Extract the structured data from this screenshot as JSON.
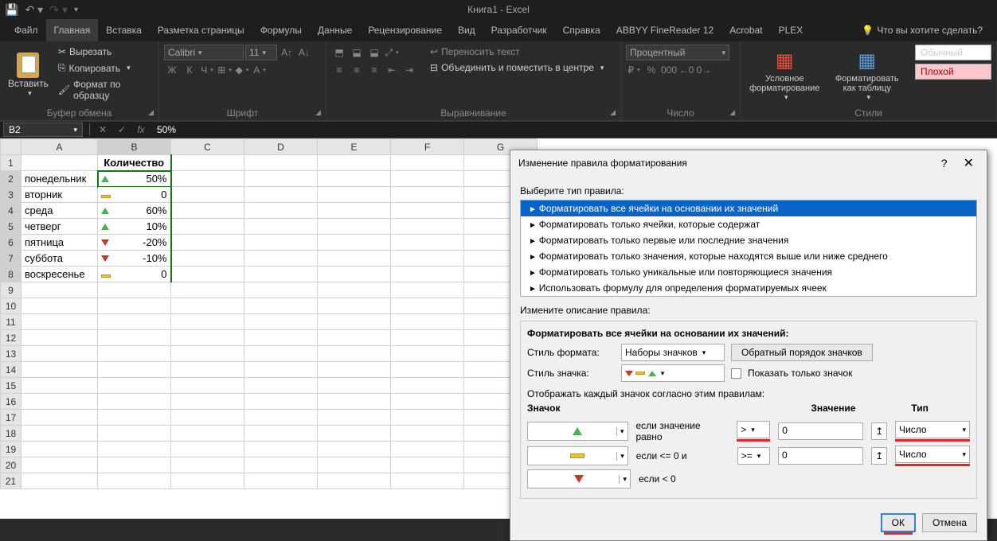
{
  "title": "Книга1 - Excel",
  "tabs": {
    "file": "Файл",
    "home": "Главная",
    "insert": "Вставка",
    "layout": "Разметка страницы",
    "formulas": "Формулы",
    "data": "Данные",
    "review": "Рецензирование",
    "view": "Вид",
    "dev": "Разработчик",
    "help": "Справка",
    "abbyy": "ABBYY FineReader 12",
    "acrobat": "Acrobat",
    "plex": "PLEX",
    "tellme": "Что вы хотите сделать?"
  },
  "clipboard": {
    "paste": "Вставить",
    "cut": "Вырезать",
    "copy": "Копировать",
    "format": "Формат по образцу",
    "label": "Буфер обмена"
  },
  "font": {
    "family": "Calibri",
    "size": "11",
    "label": "Шрифт",
    "bold": "Ж",
    "italic": "К",
    "underline": "Ч"
  },
  "align": {
    "label": "Выравнивание",
    "wrap": "Переносить текст",
    "merge": "Объединить и поместить в центре"
  },
  "number": {
    "label": "Число",
    "format": "Процентный"
  },
  "styles": {
    "label": "Стили",
    "cond": "Условное форматирование",
    "table": "Форматировать как таблицу",
    "normal": "Обычный",
    "bad": "Плохой"
  },
  "namebox": "B2",
  "formula": "50%",
  "columns": [
    "A",
    "B",
    "C",
    "D",
    "E",
    "F",
    "G"
  ],
  "rows": [
    "1",
    "2",
    "3",
    "4",
    "5",
    "6",
    "7",
    "8",
    "9",
    "10",
    "11",
    "12",
    "13",
    "14",
    "15",
    "16",
    "17",
    "18",
    "19",
    "20",
    "21"
  ],
  "data_cells": {
    "header": "Количество",
    "r": [
      {
        "a": "понедельник",
        "b": "50%",
        "i": "up"
      },
      {
        "a": "вторник",
        "b": "0",
        "i": "bar"
      },
      {
        "a": "среда",
        "b": "60%",
        "i": "up"
      },
      {
        "a": "четверг",
        "b": "10%",
        "i": "up"
      },
      {
        "a": "пятница",
        "b": "-20%",
        "i": "down"
      },
      {
        "a": "суббота",
        "b": "-10%",
        "i": "down"
      },
      {
        "a": "воскресенье",
        "b": "0",
        "i": "bar"
      }
    ]
  },
  "dialog": {
    "title": "Изменение правила форматирования",
    "select_label": "Выберите тип правила:",
    "rules": [
      "Форматировать все ячейки на основании их значений",
      "Форматировать только ячейки, которые содержат",
      "Форматировать только первые или последние значения",
      "Форматировать только значения, которые находятся выше или ниже среднего",
      "Форматировать только уникальные или повторяющиеся значения",
      "Использовать формулу для определения форматируемых ячеек"
    ],
    "edit_label": "Измените описание правила:",
    "desc_head": "Форматировать все ячейки на основании их значений:",
    "style_label": "Стиль формата:",
    "style_value": "Наборы значков",
    "reverse": "Обратный порядок значков",
    "icon_label": "Стиль значка:",
    "show_only": "Показать только значок",
    "display_label": "Отображать каждый значок согласно этим правилам:",
    "col_icon": "Значок",
    "col_value": "Значение",
    "col_type": "Тип",
    "rule1_text": "если значение равно",
    "rule1_op": ">",
    "rule1_val": "0",
    "rule1_type": "Число",
    "rule2_text": "если <= 0 и",
    "rule2_op": ">=",
    "rule2_val": "0",
    "rule2_type": "Число",
    "rule3_text": "если < 0",
    "ok": "ОК",
    "cancel": "Отмена"
  }
}
